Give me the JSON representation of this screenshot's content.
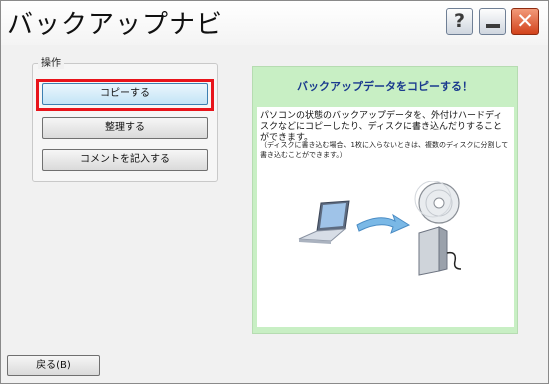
{
  "window": {
    "title": "バックアップナビ",
    "help_glyph": "?",
    "close_glyph": "✕"
  },
  "operations": {
    "group_label": "操作",
    "copy_label": "コピーする",
    "organize_label": "整理する",
    "comment_label": "コメントを記入する"
  },
  "info_panel": {
    "heading": "バックアップデータをコピーする！",
    "description": "パソコンの状態のバックアップデータを、外付けハードディスクなどにコピーしたり、ディスクに書き込んだりすることができます。",
    "note": "（ディスクに書き込む場合、1枚に入らないときは、複数のディスクに分割して書き込むことができます。）",
    "illustration_icons": [
      "laptop-icon",
      "arrow-icon",
      "disc-icon",
      "external-hdd-icon"
    ]
  },
  "footer": {
    "back_label": "戻る(B)"
  },
  "colors": {
    "highlight": "#e8141b",
    "panel_bg": "#c8efc4",
    "heading_text": "#1a3a8e",
    "close_button": "#d2421b"
  }
}
